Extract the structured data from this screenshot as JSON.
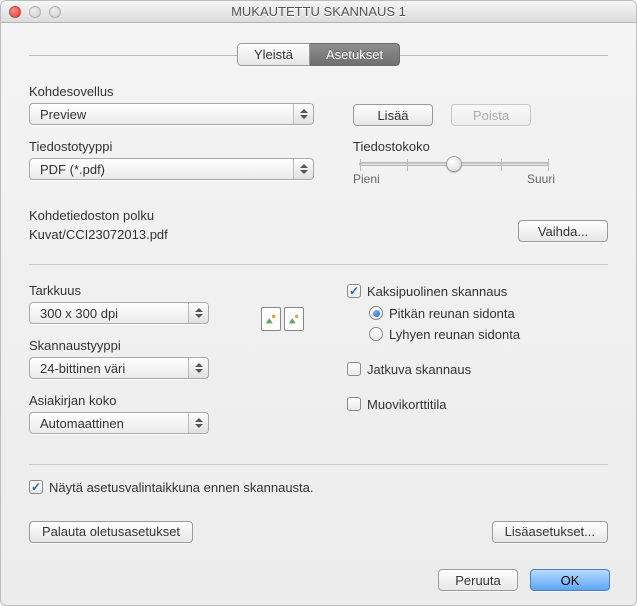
{
  "window": {
    "title": "MUKAUTETTU SKANNAUS 1"
  },
  "tabs": {
    "general": "Yleistä",
    "settings": "Asetukset"
  },
  "targetApp": {
    "label": "Kohdesovellus",
    "value": "Preview"
  },
  "addBtn": "Lisää",
  "removeBtn": "Poista",
  "fileType": {
    "label": "Tiedostotyyppi",
    "value": "PDF (*.pdf)"
  },
  "fileSize": {
    "label": "Tiedostokoko",
    "minLabel": "Pieni",
    "maxLabel": "Suuri"
  },
  "destPath": {
    "label": "Kohdetiedoston polku",
    "value": "Kuvat/CCI23072013.pdf"
  },
  "changeBtn": "Vaihda...",
  "resolution": {
    "label": "Tarkkuus",
    "value": "300 x 300 dpi"
  },
  "scanType": {
    "label": "Skannaustyyppi",
    "value": "24-bittinen väri"
  },
  "docSize": {
    "label": "Asiakirjan koko",
    "value": "Automaattinen"
  },
  "duplex": {
    "label": "Kaksipuolinen skannaus",
    "longEdge": "Pitkän reunan sidonta",
    "shortEdge": "Lyhyen reunan sidonta"
  },
  "continuous": "Jatkuva skannaus",
  "cardMode": "Muovikorttitila",
  "showDialog": "Näytä asetusvalintaikkuna ennen skannausta.",
  "restoreDefaults": "Palauta oletusasetukset",
  "advanced": "Lisäasetukset...",
  "cancel": "Peruuta",
  "ok": "OK"
}
